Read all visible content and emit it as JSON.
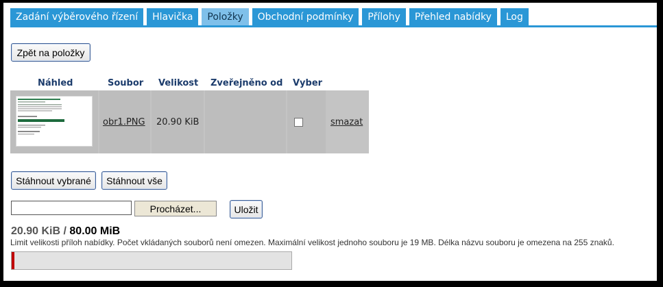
{
  "tabs": [
    {
      "label": "Zadání výběrového řízení",
      "active": false
    },
    {
      "label": "Hlavička",
      "active": false
    },
    {
      "label": "Položky",
      "active": true
    },
    {
      "label": "Obchodní podmínky",
      "active": false
    },
    {
      "label": "Přílohy",
      "active": false
    },
    {
      "label": "Přehled nabídky",
      "active": false
    },
    {
      "label": "Log",
      "active": false
    }
  ],
  "back_button": "Zpět na položky",
  "table": {
    "headers": [
      "Náhled",
      "Soubor",
      "Velikost",
      "Zveřejněno od",
      "Vyber"
    ],
    "rows": [
      {
        "file": "obr1.PNG",
        "size": "20.90 KiB",
        "published": "",
        "selected": false,
        "delete": "smazat"
      }
    ]
  },
  "download_selected": "Stáhnout vybrané",
  "download_all": "Stáhnout vše",
  "upload": {
    "file_value": "",
    "browse_label": "Procházet...",
    "save_label": "Uložit"
  },
  "usage": {
    "used": "20.90 KiB",
    "separator": " / ",
    "max": "80.00 MiB",
    "fraction": 0.0003,
    "limit_text": "Limit velikosti příloh nabídky. Počet vkládaných souborů není omezen. Maximální velikost jednoho souboru je 19 MB. Délka názvu souboru je omezena na 255 znaků."
  },
  "colors": {
    "tab": "#2a97d6",
    "tab_active": "#7fc0ea",
    "progress": "#c00000"
  }
}
